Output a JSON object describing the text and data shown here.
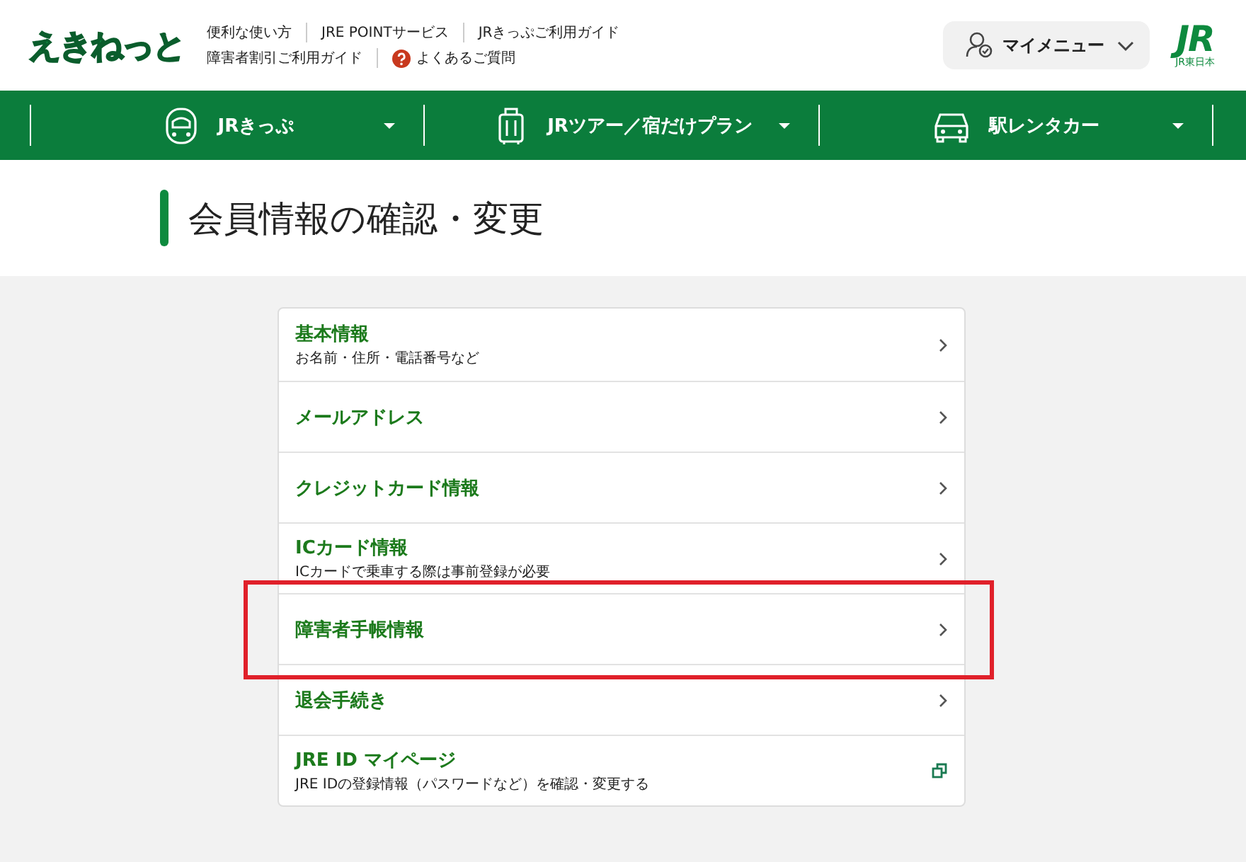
{
  "header": {
    "logo": "えきねっと",
    "links": [
      [
        {
          "label": "便利な使い方",
          "help": false
        },
        {
          "label": "JRE POINTサービス",
          "help": false
        },
        {
          "label": "JRきっぷご利用ガイド",
          "help": false
        }
      ],
      [
        {
          "label": "障害者割引ご利用ガイド",
          "help": false
        },
        {
          "label": "よくあるご質問",
          "help": true
        }
      ]
    ],
    "my_menu": "マイメニュー",
    "brand": {
      "mark": "JR",
      "name": "JR東日本"
    }
  },
  "nav": [
    {
      "label": "JRきっぷ",
      "kind": "train"
    },
    {
      "label": "JRツアー／宿だけプラン",
      "kind": "suitcase"
    },
    {
      "label": "駅レンタカー",
      "kind": "car"
    }
  ],
  "page_title": "会員情報の確認・変更",
  "menu": [
    {
      "title": "基本情報",
      "subtitle": "お名前・住所・電話番号など",
      "kind": "internal",
      "highlighted": false
    },
    {
      "title": "メールアドレス",
      "kind": "internal",
      "highlighted": false
    },
    {
      "title": "クレジットカード情報",
      "kind": "internal",
      "highlighted": false
    },
    {
      "title": "ICカード情報",
      "subtitle": "ICカードで乗車する際は事前登録が必要",
      "kind": "internal",
      "highlighted": false
    },
    {
      "title": "障害者手帳情報",
      "kind": "internal",
      "highlighted": true
    },
    {
      "title": "退会手続き",
      "kind": "internal",
      "highlighted": false
    },
    {
      "title": "JRE ID マイページ",
      "subtitle": "JRE IDの登録情報（パスワードなど）を確認・変更する",
      "kind": "external",
      "highlighted": false
    }
  ]
}
